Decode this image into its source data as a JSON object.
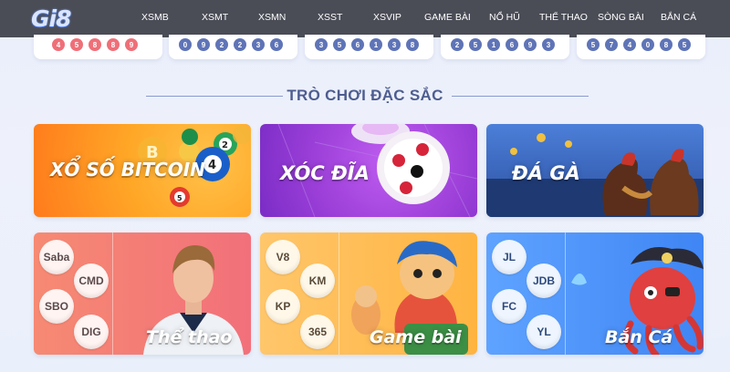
{
  "header": {
    "logo": "Gi8",
    "nav": [
      "XSMB",
      "XSMT",
      "XSMN",
      "XSST",
      "XSVIP",
      "GAME BÀI",
      "NỔ HŨ",
      "THỂ THAO",
      "SÒNG BÀI",
      "BẮN CÁ"
    ]
  },
  "results": [
    {
      "balls": [
        "4",
        "5",
        "8",
        "8",
        "9"
      ],
      "color": "red"
    },
    {
      "balls": [
        "0",
        "9",
        "2",
        "2",
        "3",
        "6"
      ],
      "color": "blue"
    },
    {
      "balls": [
        "3",
        "5",
        "6",
        "1",
        "3",
        "8"
      ],
      "color": "blue"
    },
    {
      "balls": [
        "2",
        "5",
        "1",
        "6",
        "9",
        "3"
      ],
      "color": "blue"
    },
    {
      "balls": [
        "5",
        "7",
        "4",
        "0",
        "8",
        "5"
      ],
      "color": "blue"
    }
  ],
  "section": {
    "title": "TRÒ CHƠI ĐẶC SẮC"
  },
  "games": {
    "xoso": "XỔ SỐ BITCOIN",
    "xocdia": "XÓC ĐĨA",
    "daga": "ĐÁ GÀ",
    "thethao": {
      "label": "Thể thao",
      "providers": [
        "Saba",
        "CMD",
        "SBO",
        "DIG"
      ]
    },
    "gamebai": {
      "label": "Game bài",
      "providers": [
        "V8",
        "KM",
        "KP",
        "365"
      ]
    },
    "banca": {
      "label": "Bắn Cá",
      "providers": [
        "JL",
        "JDB",
        "FC",
        "YL"
      ]
    }
  },
  "colors": {
    "header_bg": "#4a4c56",
    "ball_red": "#ef6f78",
    "ball_blue": "#5f74b7",
    "title": "#4e5d8f"
  }
}
